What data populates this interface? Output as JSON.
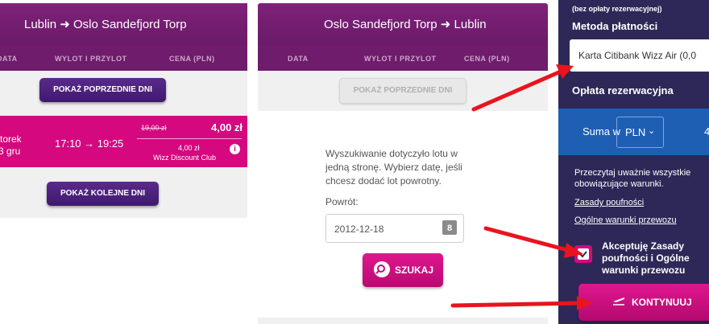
{
  "outbound": {
    "title": "Lublin ➜ Oslo Sandefjord Torp",
    "columns": [
      "DATA",
      "WYLOT I PRZYLOT",
      "CENA (PLN)"
    ],
    "prev_days_label": "POKAŻ POPRZEDNIE DNI",
    "flight": {
      "day": "torek",
      "date": "3 gru",
      "time": "17:10 → 19:25",
      "old_price": "19,00 zł",
      "price": "4,00 zł",
      "club_price": "4,00 zł",
      "club_label": "Wizz Discount Club"
    },
    "next_days_label": "POKAŻ KOLEJNE DNI"
  },
  "return": {
    "title": "Oslo Sandefjord Torp ➜ Lublin",
    "columns": [
      "DATA",
      "WYLOT I PRZYLOT",
      "CENA (PLN)"
    ],
    "prev_days_label": "POKAŻ POPRZEDNIE DNI",
    "one_way_note": "Wyszukiwanie dotyczyło lotu w jedną stronę. Wybierz datę, jeśli chcesz dodać lot powrotny.",
    "return_label": "Powrót:",
    "return_date": "2012-12-18",
    "search_label": "SZUKAJ"
  },
  "sidebar": {
    "top_note": "(bez opłaty rezerwacyjnej)",
    "payment_method_label": "Metoda płatności",
    "payment_method_value": "Karta Citibank Wizz Air (0,0",
    "booking_fee_label": "Opłata rezerwacyjna",
    "sum_label": "Suma w",
    "currency": "PLN",
    "sum_value": "4",
    "terms_note": "Przeczytaj uważnie wszystkie obowiązujące warunki.",
    "privacy_link": "Zasady poufności",
    "general_terms_link": "Ogólne warunki przewozu",
    "accept_label": "Akceptuję Zasady poufności i Ogólne warunki przewozu",
    "accept_checked": true,
    "continue_label": "KONTYNUUJ"
  },
  "colors": {
    "header_purple": "#7e2179",
    "sidebar_navy": "#2d2858",
    "accent_magenta": "#d5087f",
    "arrow_red": "#e8141e"
  }
}
